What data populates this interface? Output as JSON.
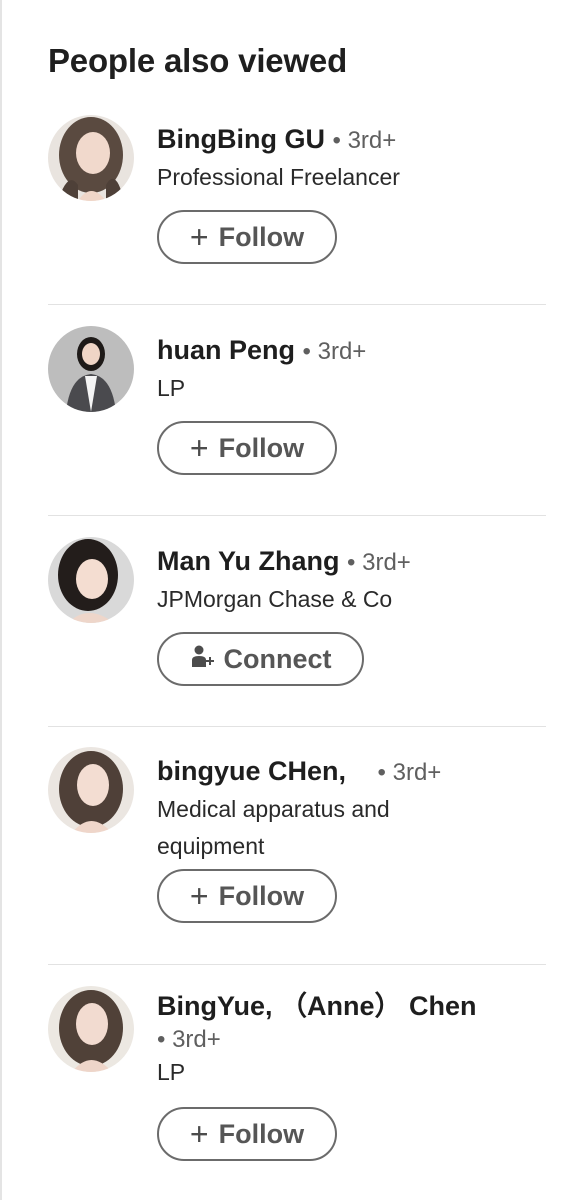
{
  "section": {
    "title": "People also viewed"
  },
  "people": [
    {
      "name": "BingBing GU",
      "degree": "• 3rd+",
      "headline": "Professional Freelancer",
      "action": "Follow",
      "action_icon": "plus-icon"
    },
    {
      "name": "huan Peng",
      "degree": "• 3rd+",
      "headline": "LP",
      "action": "Follow",
      "action_icon": "plus-icon"
    },
    {
      "name": "Man Yu Zhang",
      "degree": "• 3rd+",
      "headline": "JPMorgan Chase & Co",
      "action": "Connect",
      "action_icon": "add-person-icon"
    },
    {
      "name": "bingyue CHen,",
      "degree": "• 3rd+",
      "headline_line1": "Medical apparatus and",
      "headline_line2": "equipment",
      "action": "Follow",
      "action_icon": "plus-icon"
    },
    {
      "name": "BingYue, （Anne） Chen",
      "degree": "• 3rd+",
      "headline": "LP",
      "action": "Follow",
      "action_icon": "plus-icon"
    }
  ],
  "colors": {
    "border": "#e4e4e4",
    "button_border": "#6b6b6b",
    "button_text": "#565656",
    "degree_text": "#5f5f5f"
  }
}
